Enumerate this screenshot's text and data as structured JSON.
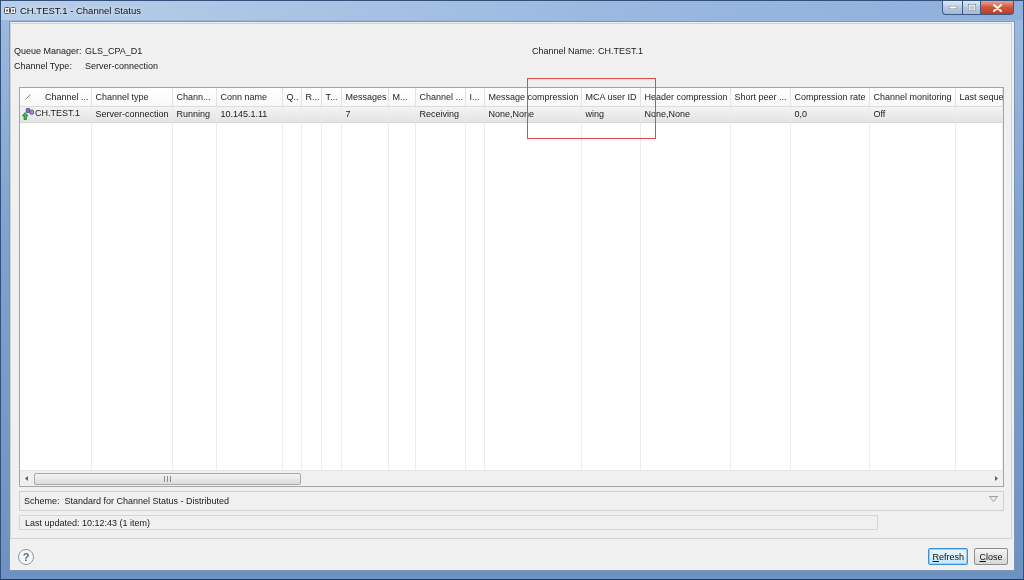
{
  "window": {
    "title": "CH.TEST.1 - Channel Status"
  },
  "details": [
    {
      "label": "Queue Manager:",
      "value": "GLS_CPA_D1"
    },
    {
      "label": "Channel Type:",
      "value": "Server-connection"
    },
    {
      "label": "Channel Name:",
      "value": "CH.TEST.1"
    }
  ],
  "table": {
    "columns": [
      {
        "label": "Channel ...",
        "sorted": true,
        "highlighted": false
      },
      {
        "label": "Channel type",
        "sorted": false,
        "highlighted": false
      },
      {
        "label": "Chann...",
        "sorted": false,
        "highlighted": false
      },
      {
        "label": "Conn name",
        "sorted": false,
        "highlighted": false
      },
      {
        "label": "Q..",
        "sorted": false,
        "highlighted": false
      },
      {
        "label": "R...",
        "sorted": false,
        "highlighted": false
      },
      {
        "label": "T...",
        "sorted": false,
        "highlighted": false
      },
      {
        "label": "Messages",
        "sorted": false,
        "highlighted": false
      },
      {
        "label": "M...",
        "sorted": false,
        "highlighted": false
      },
      {
        "label": "Channel ...",
        "sorted": false,
        "highlighted": false
      },
      {
        "label": "I...",
        "sorted": false,
        "highlighted": false
      },
      {
        "label": "Message compression",
        "sorted": false,
        "highlighted": false
      },
      {
        "label": "MCA user ID",
        "sorted": false,
        "highlighted": true
      },
      {
        "label": "Header compression",
        "sorted": false,
        "highlighted": false
      },
      {
        "label": "Short peer ...",
        "sorted": false,
        "highlighted": false
      },
      {
        "label": "Compression rate",
        "sorted": false,
        "highlighted": false
      },
      {
        "label": "Channel monitoring",
        "sorted": false,
        "highlighted": false
      },
      {
        "label": "Last seque",
        "sorted": false,
        "highlighted": false
      }
    ],
    "rows": [
      {
        "selected": true,
        "cells": [
          "CH.TEST.1",
          "Server-connection",
          "Running",
          "10.145.1.11",
          null,
          null,
          null,
          "7",
          null,
          "Receiving",
          null,
          "None,None",
          "wing",
          "None,None",
          null,
          "0,0",
          "Off",
          null
        ]
      }
    ]
  },
  "scheme": {
    "label": "Scheme:",
    "value": "Standard for Channel Status - Distributed"
  },
  "status_bar": {
    "text": "Last updated: 10:12:43 (1 item)"
  },
  "help": {
    "symbol": "?"
  },
  "buttons": [
    {
      "access_key": "R",
      "rest": "efresh",
      "default": true
    },
    {
      "access_key": "C",
      "rest": "lose",
      "default": false
    }
  ]
}
